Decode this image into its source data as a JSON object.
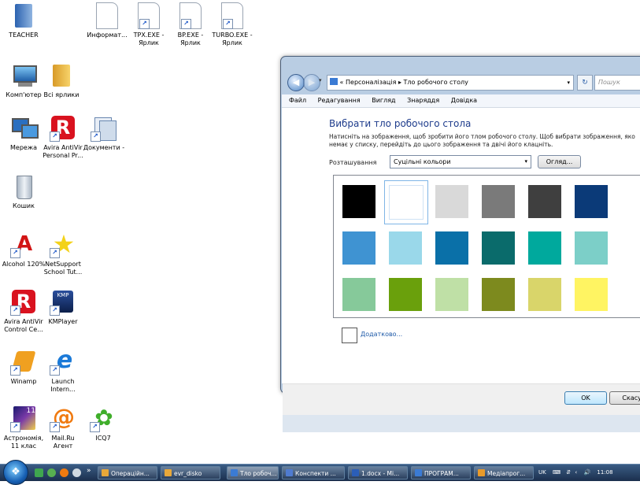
{
  "desktop": {
    "icons": [
      {
        "label": "TEACHER",
        "icon": "teacher-folder-icon"
      },
      {
        "label": "Информат...",
        "icon": "document-icon"
      },
      {
        "label": "TPX.EXE -\nЯрлик",
        "icon": "exe-shortcut-icon"
      },
      {
        "label": "BP.EXE -\nЯрлик",
        "icon": "exe-shortcut-icon"
      },
      {
        "label": "TURBO.EXE -\nЯрлик",
        "icon": "exe-shortcut-icon"
      },
      {
        "label": "Комп'ютер",
        "icon": "computer-icon"
      },
      {
        "label": "Всі ярлики",
        "icon": "folder-icon"
      },
      {
        "label": "Мережа",
        "icon": "network-icon"
      },
      {
        "label": "Avira AntiVir\nPersonal Pr...",
        "icon": "avira-icon"
      },
      {
        "label": "Документи -",
        "icon": "documents-icon"
      },
      {
        "label": "Кошик",
        "icon": "recycle-bin-icon"
      },
      {
        "label": "Alcohol 120%",
        "icon": "alcohol-icon"
      },
      {
        "label": "NetSupport\nSchool Tut...",
        "icon": "netsupport-star-icon"
      },
      {
        "label": "Avira AntiVir\nControl Ce...",
        "icon": "avira-icon"
      },
      {
        "label": "KMPlayer",
        "icon": "kmplayer-icon"
      },
      {
        "label": "Winamp",
        "icon": "winamp-icon"
      },
      {
        "label": "Launch\nIntern...",
        "icon": "internet-explorer-icon"
      },
      {
        "label": "Астрономія,\n11 клас",
        "icon": "astronomy-icon"
      },
      {
        "label": "Mail.Ru\nАгент",
        "icon": "mailru-agent-icon"
      },
      {
        "label": "ICQ7",
        "icon": "icq-flower-icon"
      }
    ]
  },
  "window": {
    "breadcrumb": {
      "prefix": "«",
      "part1": "Персоналізація",
      "sep": "▸",
      "part2": "Тло робочого столу"
    },
    "search_placeholder": "Пошук",
    "menu": [
      "Файл",
      "Редагування",
      "Вигляд",
      "Знаряддя",
      "Довідка"
    ],
    "title": "Вибрати тло робочого стола",
    "description_line1": "Натисніть на зображення, щоб зробити його тлом робочого столу. Щоб вибрати зображення, яко",
    "description_line2": "немає у списку, перейдіть до цього зображення та двічі його клацніть.",
    "location_label": "Розташування",
    "location_value": "Суцільні кольори",
    "browse_button": "Огляд...",
    "swatches": [
      [
        "#000000",
        "#ffffff",
        "#d9d9d9",
        "#7a7a7a",
        "#3f3f3f",
        "#0b3a78"
      ],
      [
        "#3f93d2",
        "#9ad8ea",
        "#0a70a8",
        "#0a6b6b",
        "#00a99d",
        "#7ccfc8"
      ],
      [
        "#86c99a",
        "#6aa00c",
        "#bfe0a6",
        "#7d8a1e",
        "#d9d56a",
        "#fff462"
      ],
      [
        "#eeee66",
        "#f7a34a",
        "#e05a2a",
        "#e8a04a",
        "#d46a2a",
        "#c8302a"
      ]
    ],
    "selected_swatch": "#ffffff",
    "advanced_link": "Додатково...",
    "ok_button": "OK",
    "cancel_button": "Скасув"
  },
  "taskbar": {
    "buttons": [
      {
        "label": "Операційн...",
        "color": "#e8a83a"
      },
      {
        "label": "evr_disko",
        "color": "#e8a83a"
      },
      {
        "label": "Тло робоч...",
        "color": "#3b7bd4"
      },
      {
        "label": "Конспекти ...",
        "color": "#4f7bd0"
      },
      {
        "label": "1.docx - Mi...",
        "color": "#2b5eb8"
      },
      {
        "label": "ПРОГРАМ...",
        "color": "#3b7bd4"
      },
      {
        "label": "Медіапрог...",
        "color": "#e89a2a"
      }
    ],
    "language": "UK",
    "clock": "11:08",
    "more_arrow": "»"
  }
}
